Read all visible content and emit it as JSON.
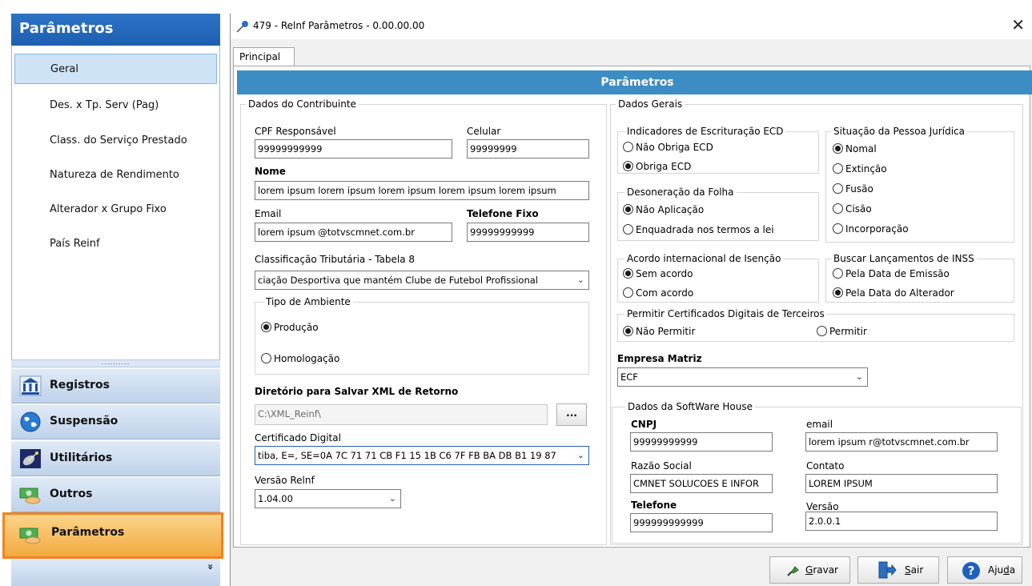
{
  "sidebar": {
    "title": "Parâmetros",
    "items": [
      {
        "label": "Geral",
        "selected": true
      },
      {
        "label": "Des. x Tp. Serv (Pag)"
      },
      {
        "label": "Class. do Serviço Prestado"
      },
      {
        "label": "Natureza de Rendimento"
      },
      {
        "label": "Alterador x Grupo Fixo"
      },
      {
        "label": "País Reinf"
      }
    ],
    "splitter": "..........",
    "modules": [
      {
        "label": "Registros",
        "icon": "bank-icon"
      },
      {
        "label": "Suspensão",
        "icon": "globe-icon"
      },
      {
        "label": "Utilitários",
        "icon": "satellite-icon"
      },
      {
        "label": "Outros",
        "icon": "money-icon"
      },
      {
        "label": "Parâmetros",
        "icon": "money-icon",
        "active": true
      }
    ],
    "expand_glyph": "»"
  },
  "window": {
    "title": "479 - Relnf Parâmetros - 0.00.00.00",
    "close": "✕",
    "tab": "Principal",
    "header": "Parâmetros"
  },
  "contribuinte": {
    "legend": "Dados do Contribuinte",
    "cpf_label": "CPF Responsável",
    "cpf_value": "99999999999",
    "celular_label": "Celular",
    "celular_value": "99999999",
    "nome_label": "Nome",
    "nome_value": "lorem ipsum lorem ipsum lorem ipsum lorem ipsum lorem ipsum",
    "email_label": "Email",
    "email_value": "lorem ipsum @totvscmnet.com.br",
    "telefone_label": "Telefone Fixo",
    "telefone_value": "99999999999",
    "classificacao_label": "Classificação Tributária - Tabela 8",
    "classificacao_value": "ciação Desportiva que mantém Clube de Futebol Profissional",
    "ambiente_legend": "Tipo de Ambiente",
    "ambiente_producao": "Produção",
    "ambiente_homologacao": "Homologação",
    "diretorio_label": "Diretório para Salvar XML de Retorno",
    "diretorio_value": "C:\\XML_Reinf\\",
    "diretorio_button": "...",
    "certificado_label": "Certificado Digital",
    "certificado_value": "tiba, E=, SE=0A 7C 71 71 CB F1 15 1B C6 7F FB BA DB B1 19 87",
    "versao_label": "Versão Relnf",
    "versao_value": "1.04.00"
  },
  "gerais": {
    "legend": "Dados Gerais",
    "ecd_legend": "Indicadores de Escrituração ECD",
    "ecd_options": [
      "Não Obriga ECD",
      "Obriga ECD"
    ],
    "ecd_selected": 1,
    "deson_legend": "Desoneração da Folha",
    "deson_options": [
      "Não Aplicação",
      "Enquadrada nos termos a lei"
    ],
    "deson_selected": 0,
    "situacao_legend": "Situação da Pessoa Jurídica",
    "situacao_options": [
      "Nomal",
      "Extinção",
      "Fusão",
      "Cisão",
      "Incorporação"
    ],
    "situacao_selected": 0,
    "acordo_legend": "Acordo internacional de Isenção",
    "acordo_options": [
      "Sem acordo",
      "Com acordo"
    ],
    "acordo_selected": 0,
    "buscar_legend": "Buscar Lançamentos de INSS",
    "buscar_options": [
      "Pela Data de Emissão",
      "Pela Data do Alterador"
    ],
    "buscar_selected": 1,
    "cert_legend": "Permitir Certificados Digitais de Terceiros",
    "cert_options": [
      "Não Permitir",
      "Permitir"
    ],
    "cert_selected": 0,
    "matriz_label": "Empresa Matriz",
    "matriz_value": "ECF"
  },
  "software_house": {
    "legend": "Dados da SoftWare House",
    "cnpj_label": "CNPJ",
    "cnpj_value": "99999999999",
    "email_label": "email",
    "email_value": "lorem ipsum r@totvscmnet.com.br",
    "razao_label": "Razão Social",
    "razao_value": "CMNET SOLUCOES E INFOR",
    "contato_label": "Contato",
    "contato_value": "LOREM IPSUM",
    "telefone_label": "Telefone",
    "telefone_value": "999999999999",
    "versao_label": "Versão",
    "versao_value": "2.0.0.1"
  },
  "buttons": {
    "gravar_pre": "",
    "gravar_u": "G",
    "gravar_post": "ravar",
    "sair_pre": "",
    "sair_u": "S",
    "sair_post": "air",
    "ajuda_pre": "Aju",
    "ajuda_u": "d",
    "ajuda_post": "a"
  },
  "colors": {
    "header_blue": "#3d8dc4",
    "nav_title_blue": "#1e5fb0",
    "active_orange": "#f58220"
  }
}
